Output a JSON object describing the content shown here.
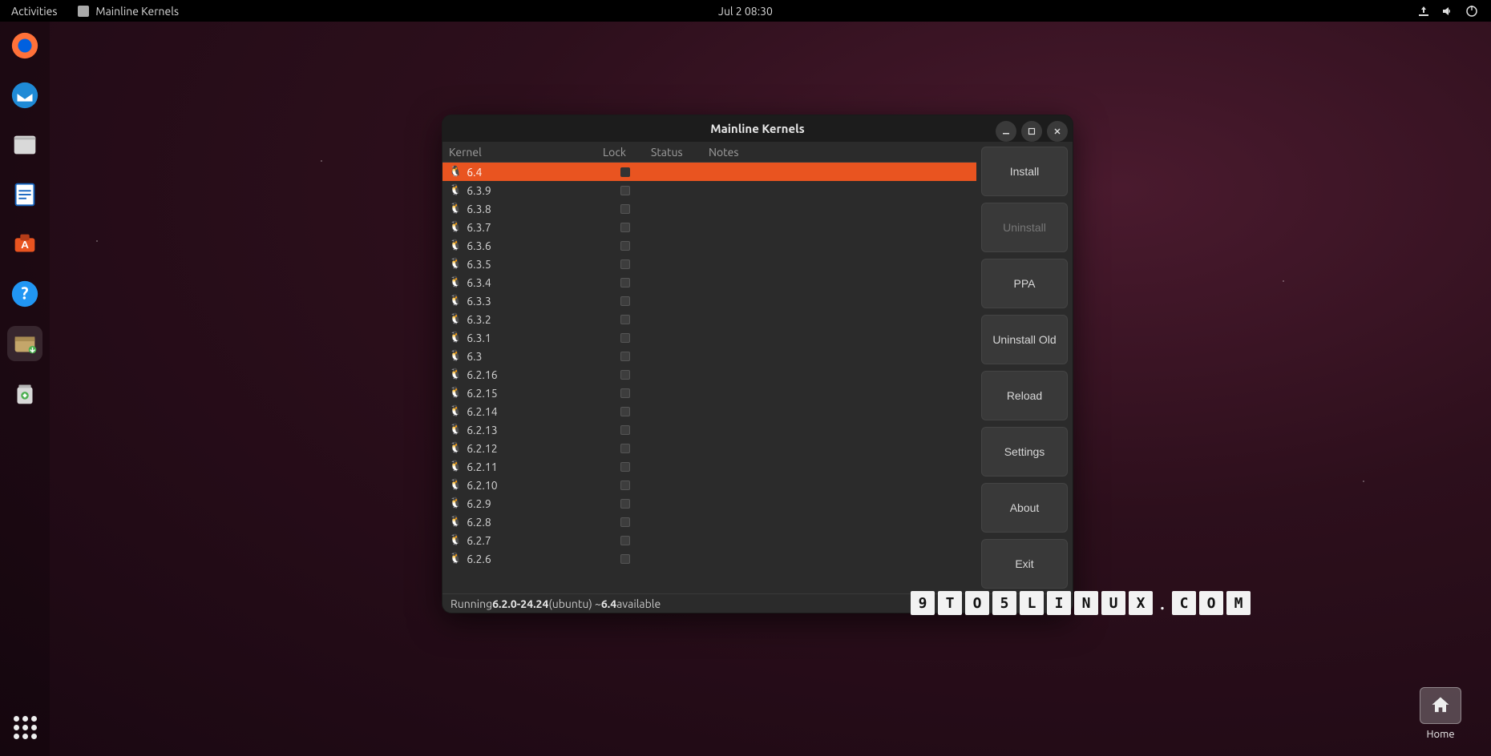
{
  "topbar": {
    "activities_label": "Activities",
    "app_name": "Mainline Kernels",
    "datetime": "Jul 2  08:30"
  },
  "dock": {
    "items": [
      {
        "name": "firefox-icon"
      },
      {
        "name": "thunderbird-icon"
      },
      {
        "name": "files-icon"
      },
      {
        "name": "libreoffice-writer-icon"
      },
      {
        "name": "ubuntu-software-icon"
      },
      {
        "name": "help-icon"
      },
      {
        "name": "archive-manager-icon",
        "active": true
      },
      {
        "name": "trash-icon"
      }
    ]
  },
  "window": {
    "title": "Mainline Kernels",
    "columns": {
      "kernel": "Kernel",
      "lock": "Lock",
      "status": "Status",
      "notes": "Notes"
    },
    "buttons": {
      "install": "Install",
      "uninstall": "Uninstall",
      "ppa": "PPA",
      "uninstall_old": "Uninstall Old",
      "reload": "Reload",
      "settings": "Settings",
      "about": "About",
      "exit": "Exit"
    },
    "rows": [
      {
        "version": "6.4",
        "selected": true
      },
      {
        "version": "6.3.9"
      },
      {
        "version": "6.3.8"
      },
      {
        "version": "6.3.7"
      },
      {
        "version": "6.3.6"
      },
      {
        "version": "6.3.5"
      },
      {
        "version": "6.3.4"
      },
      {
        "version": "6.3.3"
      },
      {
        "version": "6.3.2"
      },
      {
        "version": "6.3.1"
      },
      {
        "version": "6.3"
      },
      {
        "version": "6.2.16"
      },
      {
        "version": "6.2.15"
      },
      {
        "version": "6.2.14"
      },
      {
        "version": "6.2.13"
      },
      {
        "version": "6.2.12"
      },
      {
        "version": "6.2.11"
      },
      {
        "version": "6.2.10"
      },
      {
        "version": "6.2.9"
      },
      {
        "version": "6.2.8"
      },
      {
        "version": "6.2.7"
      },
      {
        "version": "6.2.6"
      }
    ],
    "status": {
      "prefix": "Running ",
      "running": "6.2.0-24.24",
      "middle": " (ubuntu) ~ ",
      "available_version": "6.4",
      "suffix": " available"
    }
  },
  "desktop": {
    "home_label": "Home"
  },
  "watermark": {
    "text": "9TO5LINUX.COM"
  }
}
